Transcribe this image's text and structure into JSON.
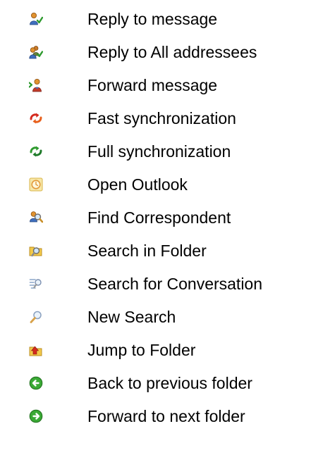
{
  "items": [
    {
      "label": "Reply to message",
      "icon": "reply-icon"
    },
    {
      "label": "Reply to All addressees",
      "icon": "reply-all-icon"
    },
    {
      "label": "Forward message",
      "icon": "forward-message-icon"
    },
    {
      "label": "Fast synchronization",
      "icon": "fast-sync-icon"
    },
    {
      "label": "Full synchronization",
      "icon": "full-sync-icon"
    },
    {
      "label": "Open Outlook",
      "icon": "outlook-clock-icon"
    },
    {
      "label": "Find Correspondent",
      "icon": "find-correspondent-icon"
    },
    {
      "label": "Search in Folder",
      "icon": "search-folder-icon"
    },
    {
      "label": "Search for Conversation",
      "icon": "search-conversation-icon"
    },
    {
      "label": "New Search",
      "icon": "magnifier-icon"
    },
    {
      "label": "Jump to Folder",
      "icon": "jump-folder-icon"
    },
    {
      "label": "Back to previous folder",
      "icon": "back-arrow-icon"
    },
    {
      "label": "Forward to next folder",
      "icon": "forward-arrow-icon"
    }
  ],
  "colors": {
    "text": "#000000",
    "sync_fast": "#d42a1e",
    "sync_full": "#2e9a2e",
    "nav_green": "#3aa935",
    "folder_yellow": "#f2c94a",
    "person_orange": "#e08a2c",
    "person_blue": "#3c6fc4"
  }
}
